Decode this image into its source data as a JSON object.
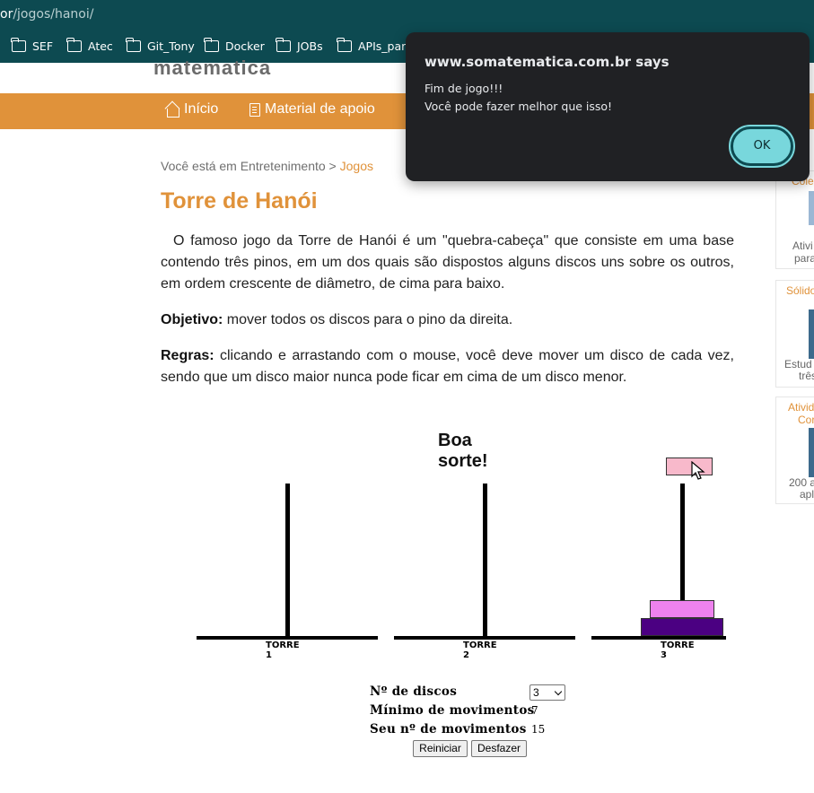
{
  "browser": {
    "url_host": "or",
    "url_path": "/jogos/hanoi/",
    "bookmarks": [
      {
        "label": "SEF"
      },
      {
        "label": "Atec"
      },
      {
        "label": "Git_Tony"
      },
      {
        "label": "Docker"
      },
      {
        "label": "JOBs"
      },
      {
        "label": "APIs_para"
      }
    ]
  },
  "site": {
    "logo_text": "matematica",
    "nav": [
      {
        "label": "Início"
      },
      {
        "label": "Material de apoio"
      }
    ]
  },
  "breadcrumb": {
    "prefix": "Você está em Entretenimento > ",
    "link": "Jogos"
  },
  "page": {
    "title": "Torre de Hanói",
    "intro": "O famoso jogo da Torre de Hanói é um \"quebra-cabeça\" que consiste em uma base contendo três pinos, em um dos quais são dispostos alguns discos uns sobre os outros, em ordem crescente de diâmetro, de cima para baixo.",
    "objective_label": "Objetivo:",
    "objective_text": " mover todos os discos para o pino da direita.",
    "rules_label": "Regras:",
    "rules_text": " clicando e arrastando com o mouse, você deve mover um disco de cada vez, sendo que um disco maior nunca pode ficar em cima de um disco menor."
  },
  "sidebar": [
    {
      "title": "Cole",
      "text1": "Ativi",
      "text2": "para"
    },
    {
      "title": "Sólido",
      "text1": "Estud",
      "text2": "três"
    },
    {
      "title": "Ativid",
      "title2": "Cor",
      "text1": "200 a",
      "text2": "apl"
    }
  ],
  "game": {
    "message": "Boa sorte!",
    "towers": [
      "TORRE 1",
      "TORRE 2",
      "TORRE 3"
    ],
    "disc_colors": [
      "#f8b9cb",
      "#ee82ee",
      "#4b0082"
    ],
    "num_discs_label": "Nº de discos",
    "num_discs_value": "3",
    "min_moves_label": "Mínimo de movimentos",
    "min_moves_value": "7",
    "your_moves_label": "Seu nº de movimentos",
    "your_moves_value": "15",
    "restart_label": "Reiniciar",
    "undo_label": "Desfazer"
  },
  "dialog": {
    "origin": "www.somatematica.com.br says",
    "line1": "Fim de jogo!!!",
    "line2": "Você pode fazer melhor que isso!",
    "ok_label": "OK"
  }
}
